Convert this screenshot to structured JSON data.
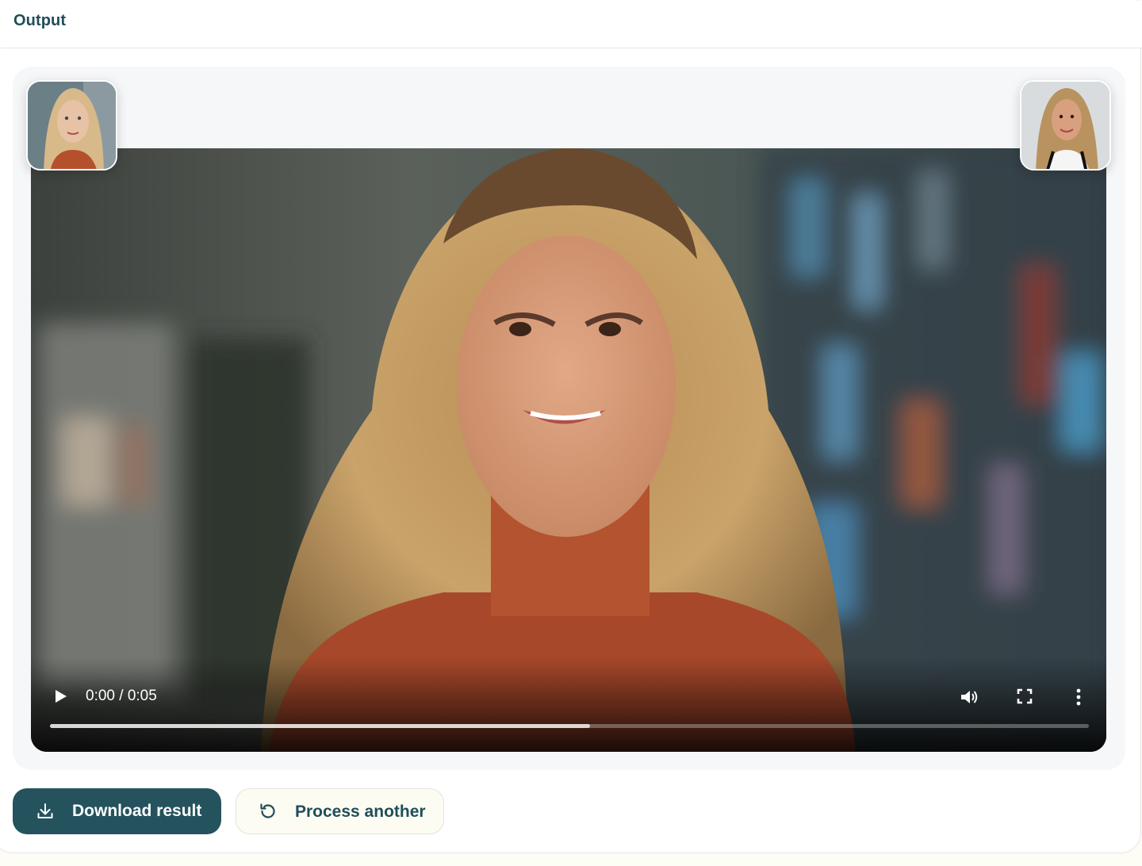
{
  "panel": {
    "title": "Output"
  },
  "video": {
    "current_time": "0:00",
    "duration": "0:05",
    "time_label": "0:00 / 0:05",
    "progress": 0.52,
    "controls": {
      "play_icon": "play-icon",
      "volume_icon": "volume-icon",
      "fullscreen_icon": "fullscreen-icon",
      "more_icon": "more-vertical-icon"
    }
  },
  "thumbnails": {
    "source_icon": "source-face-thumbnail",
    "target_icon": "target-face-thumbnail"
  },
  "actions": {
    "download_label": "Download result",
    "process_another_label": "Process another"
  },
  "colors": {
    "accent": "#24535e",
    "title": "#1f4e5a",
    "secondary_button_bg": "#fdfcf3"
  }
}
